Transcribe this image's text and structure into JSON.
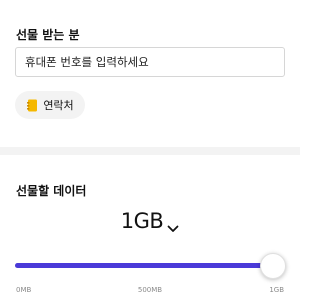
{
  "recipient": {
    "title": "선물 받는 분",
    "phone_placeholder": "휴대폰 번호를 입력하세요",
    "contact_button_label": "연락처",
    "contact_icon": "address-book-icon"
  },
  "data_gift": {
    "title": "선물할 데이터",
    "selected_amount": "1GB",
    "selector_icon": "chevron-down-icon",
    "slider": {
      "min_label": "0MB",
      "mid_label": "500MB",
      "max_label": "1GB",
      "value_fraction": 1.0,
      "fill_color": "#4a3ad8"
    }
  }
}
